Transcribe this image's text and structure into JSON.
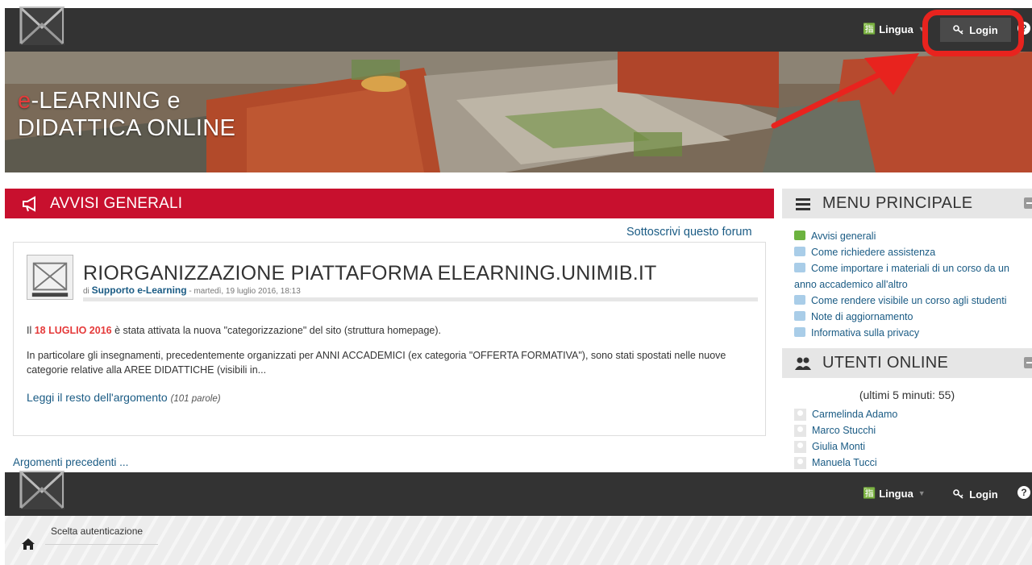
{
  "navbar_top": {
    "lingua_label": "Lingua",
    "login_label": "Login",
    "help_label": "?"
  },
  "banner": {
    "title_prefix": "e",
    "title_line1_rest": "-LEARNING e",
    "title_line2": "DIDATTICA ONLINE"
  },
  "avvisi": {
    "header_title": "AVVISI GENERALI",
    "subscribe_link": "Sottoscrivi questo forum",
    "post": {
      "title": "RIORGANIZZAZIONE PIATTAFORMA ELEARNING.UNIMIB.IT",
      "meta_by": "di",
      "author": "Supporto e-Learning",
      "meta_date": " - martedì, 19 luglio 2016, 18:13",
      "body1_prefix": "Il ",
      "body1_date": "18 LUGLIO 2016",
      "body1_rest": " è stata attivata  la nuova \"categorizzazione\" del sito (struttura homepage).",
      "body2": "In particolare gli insegnamenti, precedentemente organizzati per ANNI ACCADEMICI (ex categoria \"OFFERTA FORMATIVA\"), sono stati spostati nelle nuove categorie relative alla AREE DIDATTICHE (visibili in...",
      "readmore": "Leggi il resto dell'argomento",
      "readmore_words": "(101 parole)"
    },
    "previous_link": "Argomenti precedenti ..."
  },
  "menu_principale": {
    "title": "MENU PRINCIPALE",
    "items": [
      {
        "label": "Avvisi generali",
        "icon": "forum-icon"
      },
      {
        "label": "Come richiedere assistenza",
        "icon": "page-icon"
      },
      {
        "label": "Come importare i materiali di un corso da un anno accademico all'altro",
        "icon": "page-icon"
      },
      {
        "label": "Come rendere visibile un corso agli studenti",
        "icon": "page-icon"
      },
      {
        "label": "Note di aggiornamento",
        "icon": "page-icon"
      },
      {
        "label": "Informativa sulla privacy",
        "icon": "page-icon"
      }
    ]
  },
  "utenti_online": {
    "title": "UTENTI ONLINE",
    "count_text": "(ultimi 5 minuti: 55)",
    "users": [
      "Carmelinda Adamo",
      "Marco Stucchi",
      "Giulia Monti",
      "Manuela Tucci"
    ]
  },
  "navbar_bottom": {
    "lingua_label": "Lingua",
    "login_label": "Login",
    "help_label": "?"
  },
  "breadcrumb": {
    "label": "Scelta autenticazione"
  },
  "colors": {
    "navbar": "#333333",
    "accent_red": "#c8102e",
    "link": "#1a5b84",
    "highlight": "#e8231e"
  }
}
